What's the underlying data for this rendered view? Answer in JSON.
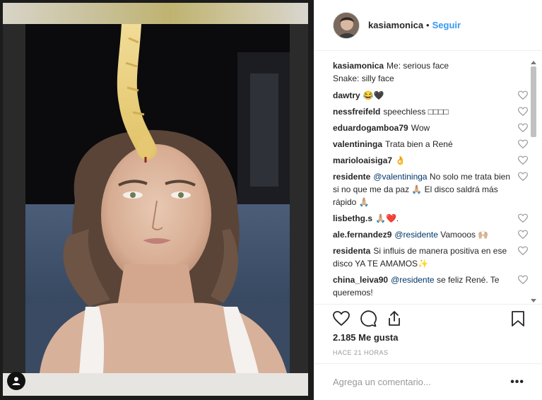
{
  "post": {
    "username": "kasiamonica",
    "follow_label": "Seguir",
    "caption_text": "Me: serious face\nSnake: silly face",
    "likes": "2.185 Me gusta",
    "time": "HACE 21 HORAS",
    "comment_placeholder": "Agrega un comentario...",
    "more_label": "•••"
  },
  "comments": [
    {
      "user": "dawtry",
      "text": "😂🖤"
    },
    {
      "user": "nessfreifeld",
      "text": "speechless □□□□"
    },
    {
      "user": "eduardogamboa79",
      "text": "Wow"
    },
    {
      "user": "valentininga",
      "text": "Trata bien a René"
    },
    {
      "user": "marioloaisiga7",
      "text": "👌"
    },
    {
      "user": "residente",
      "mention": "@valentininga",
      "text": " No solo me trata bien si no que me da paz 🙏🏼 El disco saldrá más rápido 🙏🏼"
    },
    {
      "user": "lisbethg.s",
      "text": "🙏🏼❤️."
    },
    {
      "user": "ale.fernandez9",
      "mention": "@residente",
      "text": " Vamooos 🙌🏼"
    },
    {
      "user": "residenta",
      "text": "Si influis de manera positiva en ese disco YA TE AMAMOS✨"
    },
    {
      "user": "china_leiva90",
      "mention": "@residente",
      "text": " se feliz René. Te queremos!"
    }
  ],
  "icons": {
    "heart": "heart-icon",
    "comment": "comment-icon",
    "share": "share-icon",
    "bookmark": "bookmark-icon",
    "profile": "user-icon"
  },
  "colors": {
    "link_blue": "#3897f0",
    "text": "#262626",
    "muted": "#999999"
  }
}
